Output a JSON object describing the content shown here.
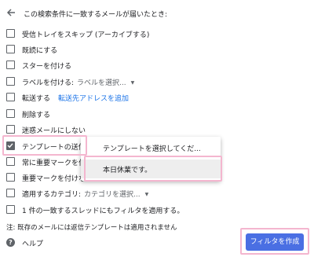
{
  "header": {
    "title": "この検索条件に一致するメールが届いたとき:",
    "back_icon": "arrow-left-icon"
  },
  "options": [
    {
      "label": "受信トレイをスキップ (アーカイブする)",
      "checked": false
    },
    {
      "label": "既読にする",
      "checked": false
    },
    {
      "label": "スターを付ける",
      "checked": false
    },
    {
      "label": "ラベルを付ける:",
      "select_value": "ラベルを選択...",
      "checked": false
    },
    {
      "label": "転送する",
      "link": "転送先アドレスを追加",
      "checked": false
    },
    {
      "label": "削除する",
      "checked": false
    },
    {
      "label": "迷惑メールにしない",
      "checked": false
    },
    {
      "label": "テンプレートの送信:",
      "checked": true
    },
    {
      "label": "常に重要マークを付ける",
      "checked": false
    },
    {
      "label": "重要マークを付けない",
      "checked": false
    },
    {
      "label": "適用するカテゴリ:",
      "select_value": "カテゴリを選択...",
      "checked": false
    },
    {
      "label": "1 件の一致するスレッドにもフィルタを適用する。",
      "checked": false
    }
  ],
  "dropdown": {
    "items": [
      "テンプレートを選択してくだ...",
      "本日休業です。"
    ],
    "selected_index": 1
  },
  "note": "注: 既存のメールには返信テンプレートは適用されません",
  "help": {
    "icon": "help-circle-icon",
    "label": "ヘルプ"
  },
  "create_button": {
    "label": "フィルタを作成",
    "color": "#4a6fe3"
  },
  "highlight_color": "#f4b6cf"
}
